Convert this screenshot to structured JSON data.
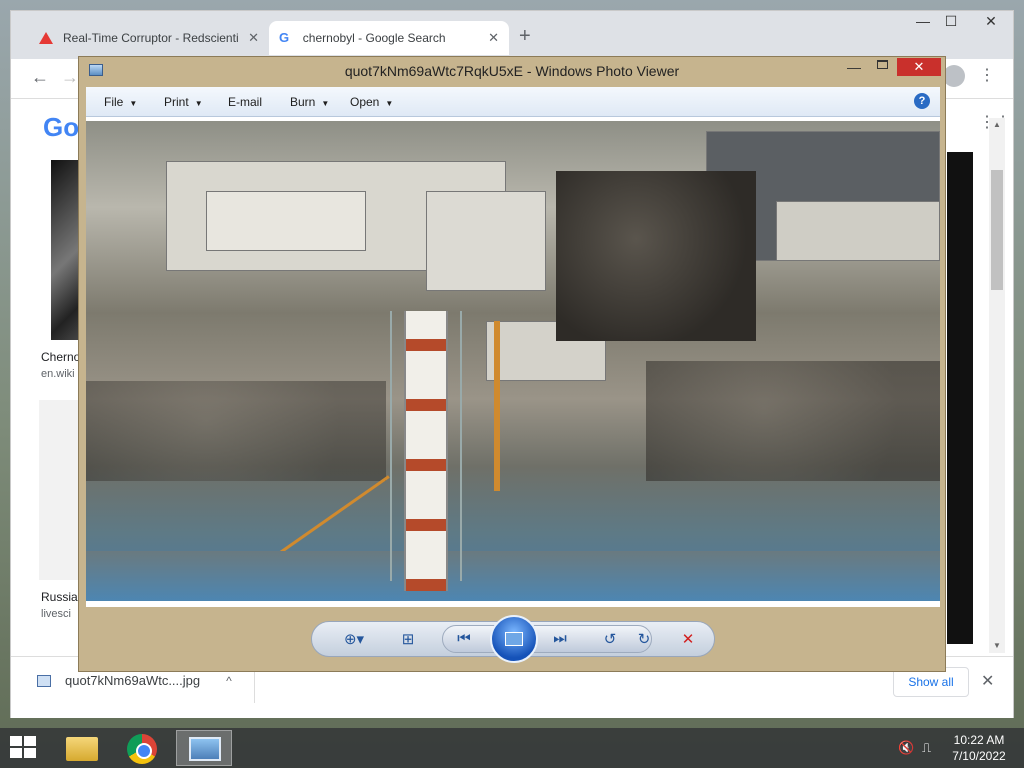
{
  "browser": {
    "tabs": [
      {
        "title": "Real-Time Corruptor - Redscienti",
        "close": "✕"
      },
      {
        "title": "chernobyl - Google Search",
        "close": "✕"
      }
    ],
    "new_tab": "+",
    "window_controls": {
      "minimize": "—",
      "maximize": "☐",
      "close": "✕"
    },
    "nav": {
      "back": "←",
      "forward": "→"
    },
    "logo": "Go",
    "results": [
      {
        "title": "Cherno",
        "source": "en.wiki"
      },
      {
        "title": "Russia",
        "source": "livesci"
      }
    ],
    "downloads": {
      "filename": "quot7kNm69aWtc....jpg",
      "show_all": "Show all",
      "close": "✕",
      "chevron": "^"
    }
  },
  "photo_viewer": {
    "title": "quot7kNm69aWtc7RqkU5xE - Windows Photo Viewer",
    "menu": [
      "File",
      "Print",
      "E-mail",
      "Burn",
      "Open"
    ],
    "menu_dropdowns": [
      true,
      true,
      false,
      true,
      true
    ],
    "help": "?",
    "close": "✕",
    "minimize": "—"
  },
  "taskbar": {
    "time": "10:22 AM",
    "date": "7/10/2022"
  },
  "colors": {
    "viewer_frame": "#c6b48e",
    "close_red": "#c9302c",
    "taskbar": "#363a3a"
  }
}
